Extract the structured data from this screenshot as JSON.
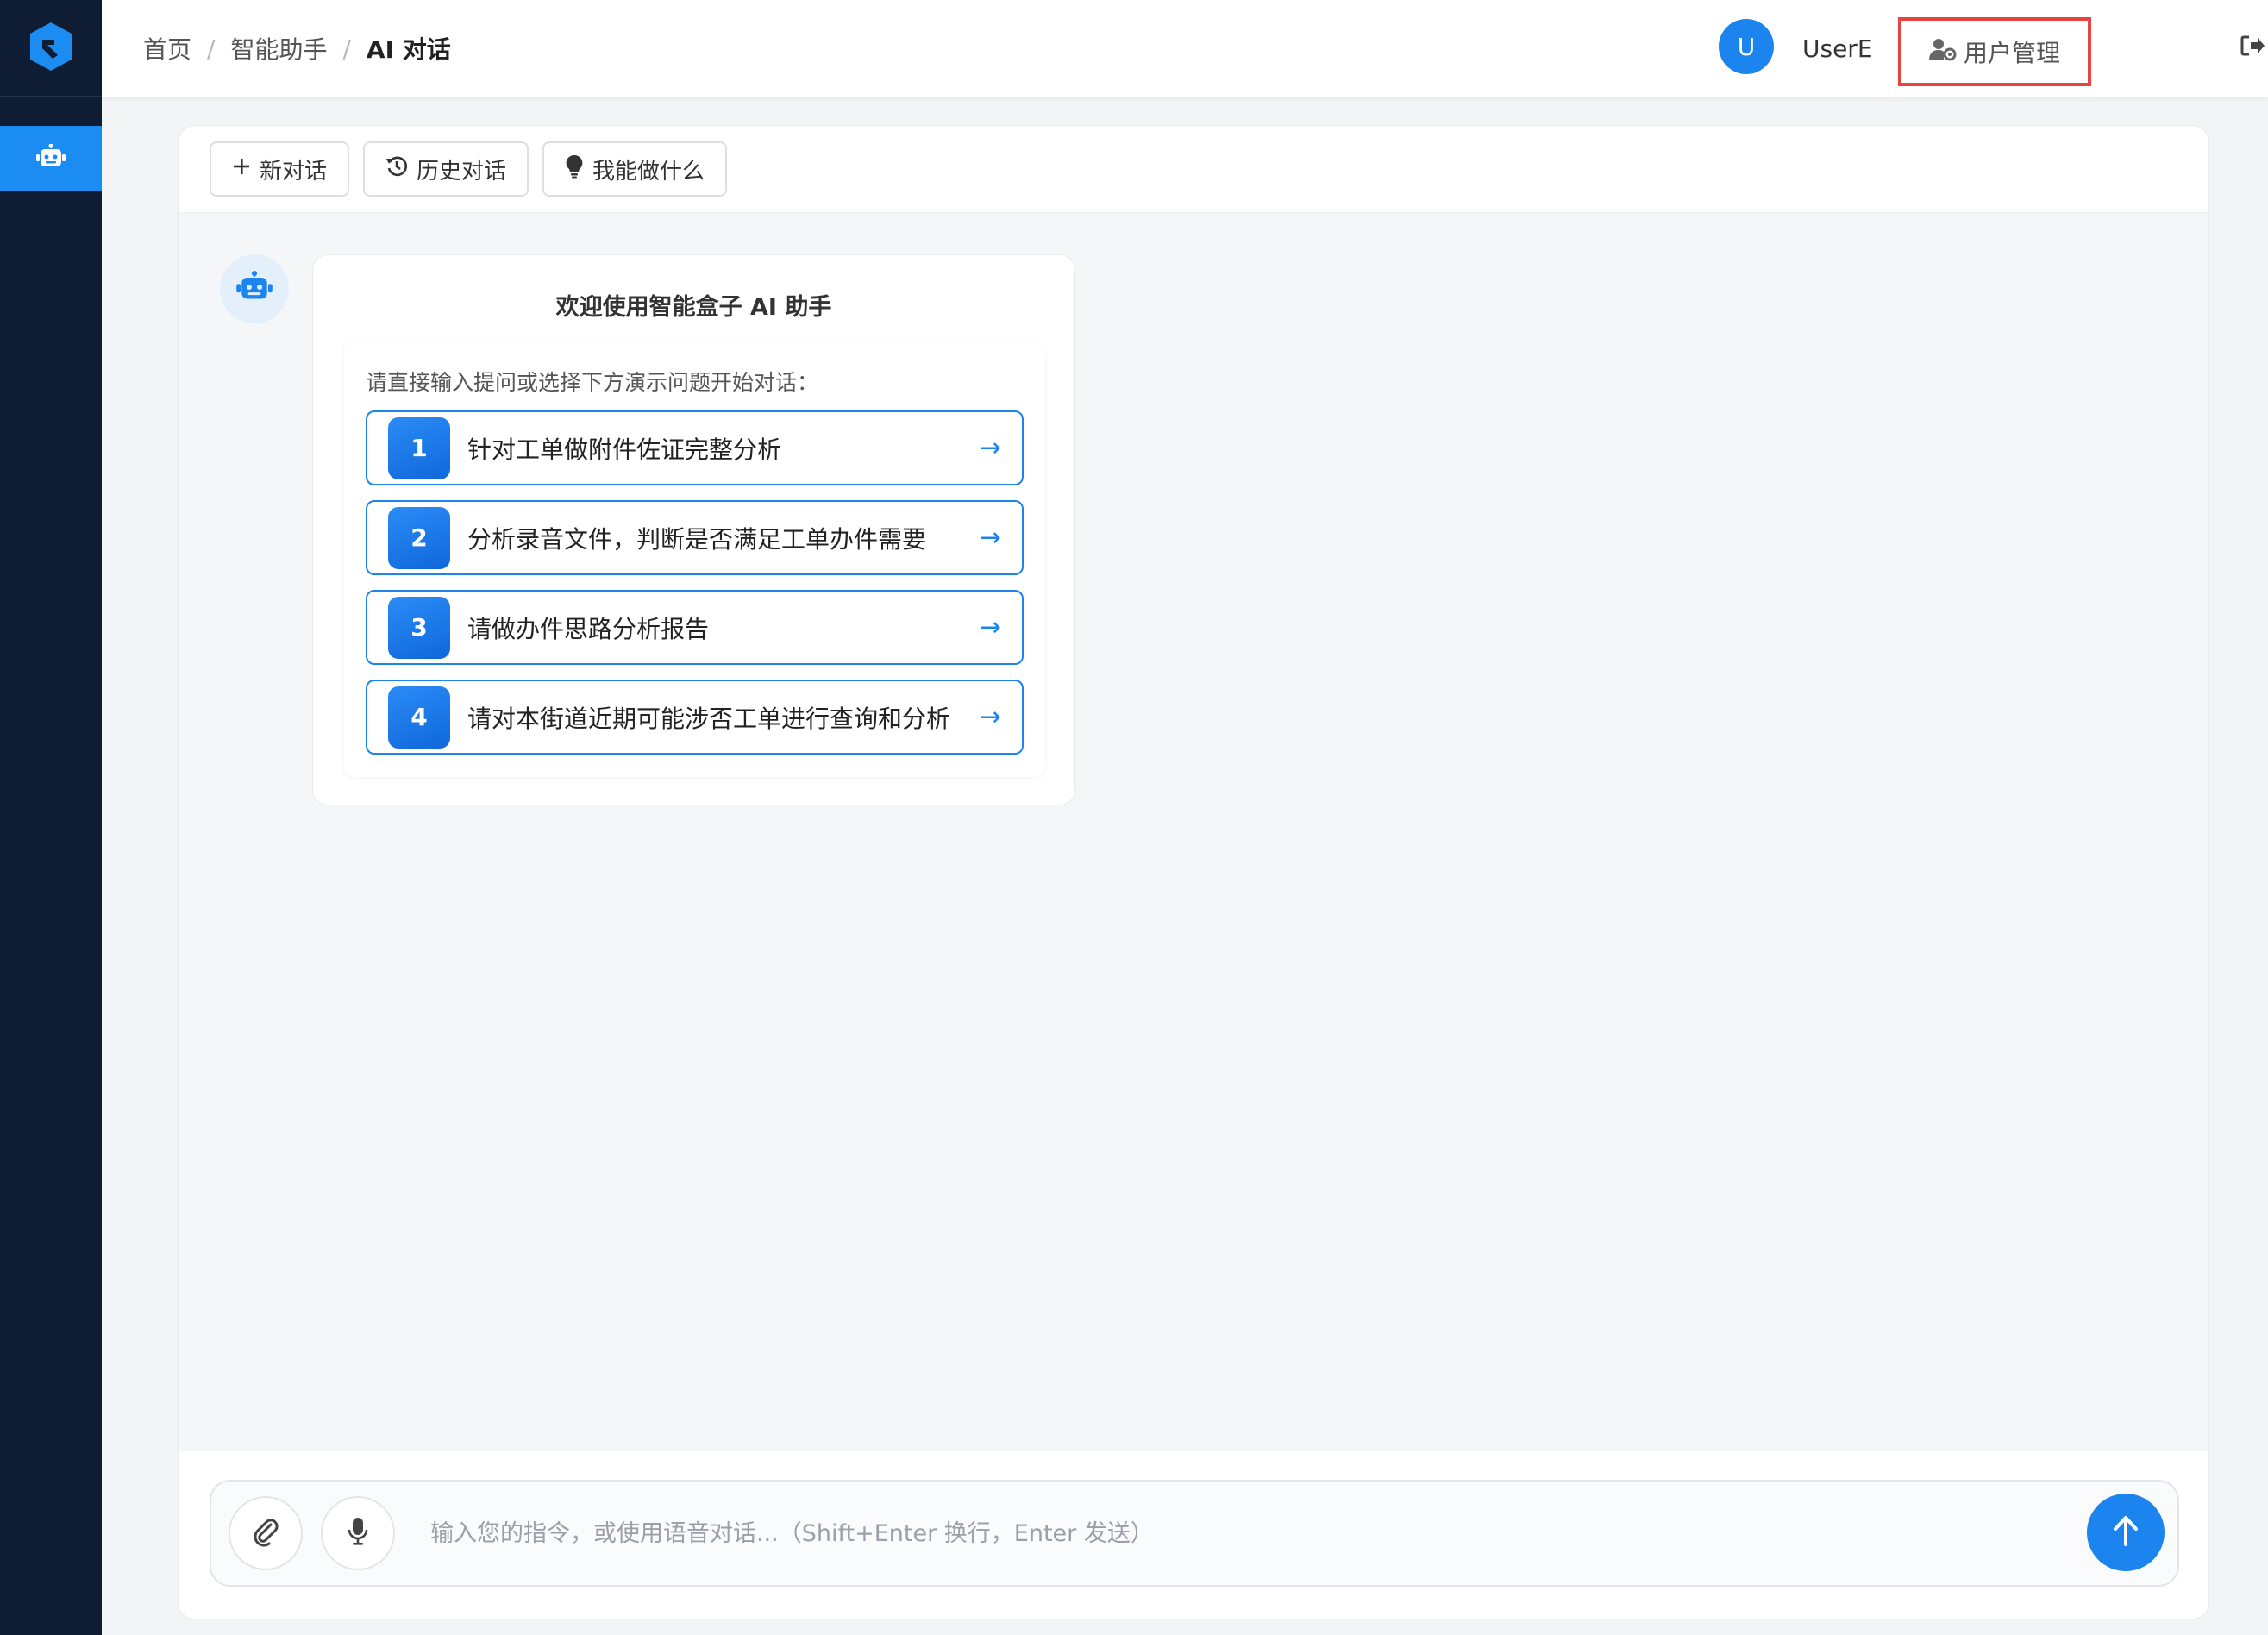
{
  "sidebar": {
    "logo_icon": "app-logo-icon",
    "active_item_icon": "robot-icon",
    "background": "#0e1d33",
    "active_color": "#1b8cf2"
  },
  "header": {
    "breadcrumb": [
      "首页",
      "智能助手",
      "AI 对话"
    ],
    "separator": "/",
    "avatar_letter": "U",
    "username": "UserE",
    "user_management": "用户管理",
    "logout": "退出"
  },
  "toolbar": {
    "new_chat": "新对话",
    "history": "历史对话",
    "capabilities": "我能做什么"
  },
  "welcome": {
    "title": "欢迎使用智能盒子 AI 助手",
    "intro": "请直接输入提问或选择下方演示问题开始对话：",
    "questions": [
      {
        "num": "1",
        "text": "针对工单做附件佐证完整分析",
        "arrow": "→"
      },
      {
        "num": "2",
        "text": "分析录音文件，判断是否满足工单办件需要",
        "arrow": "→"
      },
      {
        "num": "3",
        "text": "请做办件思路分析报告",
        "arrow": "→"
      },
      {
        "num": "4",
        "text": "请对本街道近期可能涉否工单进行查询和分析",
        "arrow": "→"
      }
    ]
  },
  "composer": {
    "placeholder": "输入您的指令，或使用语音对话...（Shift+Enter 换行，Enter 发送）",
    "value": ""
  },
  "colors": {
    "accent": "#1b84ee",
    "highlight_border": "#e8433f"
  }
}
